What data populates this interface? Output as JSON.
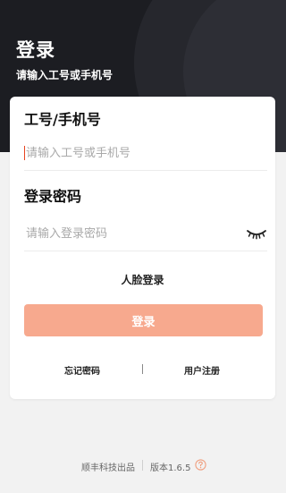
{
  "header": {
    "title": "登录",
    "subtitle": "请输入工号或手机号"
  },
  "form": {
    "account": {
      "label": "工号/手机号",
      "placeholder": "请输入工号或手机号",
      "value": ""
    },
    "password": {
      "label": "登录密码",
      "placeholder": "请输入登录密码",
      "value": "",
      "toggle_icon": "eye-closed-icon"
    },
    "face_login_label": "人脸登录",
    "login_button_label": "登录",
    "forgot_password_label": "忘记密码",
    "register_label": "用户注册"
  },
  "footer": {
    "company": "顺丰科技出品",
    "version": "版本1.6.5",
    "help_icon": "question-circle-icon"
  },
  "colors": {
    "header_bg": "#1c1d22",
    "accent": "#f7a98e",
    "caret": "#e7431f",
    "help_icon": "#f0a080"
  }
}
